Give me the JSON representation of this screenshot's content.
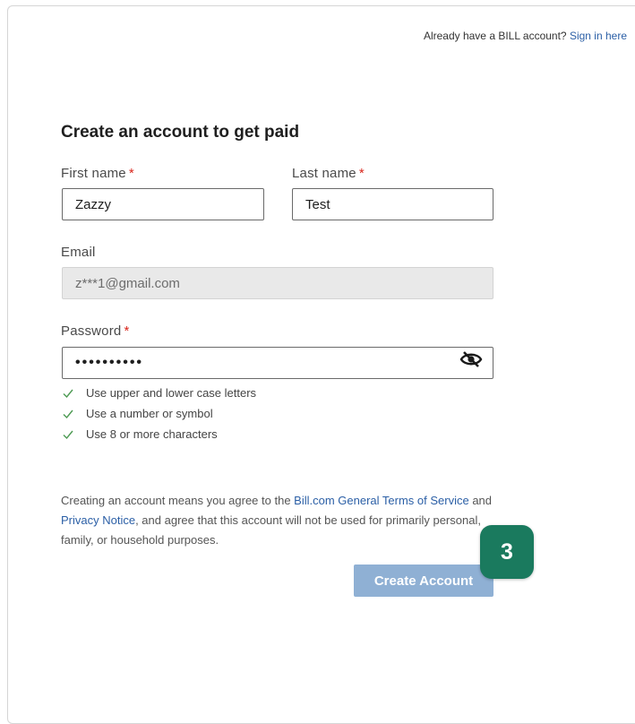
{
  "header": {
    "signin_prompt": "Already have a BILL account?",
    "signin_link": "Sign in here"
  },
  "form": {
    "title": "Create an account to get paid",
    "first_name": {
      "label": "First name",
      "value": "Zazzy"
    },
    "last_name": {
      "label": "Last name",
      "value": "Test"
    },
    "email": {
      "label": "Email",
      "value": "z***1@gmail.com"
    },
    "password": {
      "label": "Password",
      "value": "••••••••••"
    },
    "required_mark": "*",
    "password_rules": [
      "Use upper and lower case letters",
      "Use a number or symbol",
      "Use 8 or more characters"
    ]
  },
  "legal": {
    "prefix": "Creating an account means you agree to the ",
    "terms_link": "Bill.com General Terms of Service",
    "and": " and ",
    "privacy_link": "Privacy Notice",
    "suffix": ", and agree that this account will not be used for primarily personal, family, or household purposes."
  },
  "actions": {
    "create_label": "Create Account"
  },
  "badge": {
    "step": "3"
  },
  "colors": {
    "link": "#2b5fa6",
    "required": "#d9261c",
    "button": "#8fb0d4",
    "badge": "#1a7a5e",
    "check": "#4c9a52"
  },
  "icons": {
    "password_toggle": "eye-slash-icon",
    "rule_status": "check-icon"
  }
}
